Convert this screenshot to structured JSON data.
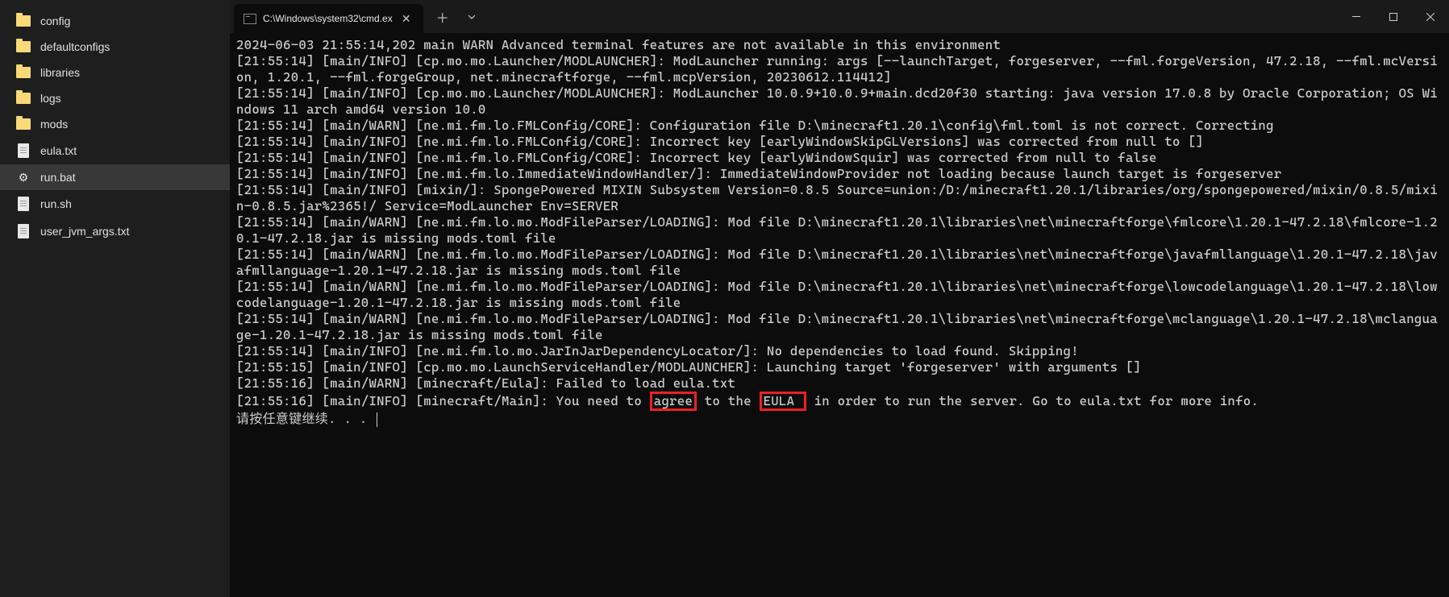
{
  "sidebar": {
    "items": [
      {
        "name": "config",
        "type": "folder"
      },
      {
        "name": "defaultconfigs",
        "type": "folder"
      },
      {
        "name": "libraries",
        "type": "folder"
      },
      {
        "name": "logs",
        "type": "folder"
      },
      {
        "name": "mods",
        "type": "folder"
      },
      {
        "name": "eula.txt",
        "type": "file"
      },
      {
        "name": "run.bat",
        "type": "gear",
        "selected": true
      },
      {
        "name": "run.sh",
        "type": "file"
      },
      {
        "name": "user_jvm_args.txt",
        "type": "file"
      }
    ]
  },
  "tab": {
    "title": "C:\\Windows\\system32\\cmd.ex"
  },
  "terminal": {
    "lines": [
      "2024-06-03 21:55:14,202 main WARN Advanced terminal features are not available in this environment",
      "[21:55:14] [main/INFO] [cp.mo.mo.Launcher/MODLAUNCHER]: ModLauncher running: args [--launchTarget, forgeserver, --fml.forgeVersion, 47.2.18, --fml.mcVersion, 1.20.1, --fml.forgeGroup, net.minecraftforge, --fml.mcpVersion, 20230612.114412]",
      "[21:55:14] [main/INFO] [cp.mo.mo.Launcher/MODLAUNCHER]: ModLauncher 10.0.9+10.0.9+main.dcd20f30 starting: java version 17.0.8 by Oracle Corporation; OS Windows 11 arch amd64 version 10.0",
      "[21:55:14] [main/WARN] [ne.mi.fm.lo.FMLConfig/CORE]: Configuration file D:\\minecraft1.20.1\\config\\fml.toml is not correct. Correcting",
      "[21:55:14] [main/INFO] [ne.mi.fm.lo.FMLConfig/CORE]: Incorrect key [earlyWindowSkipGLVersions] was corrected from null to []",
      "[21:55:14] [main/INFO] [ne.mi.fm.lo.FMLConfig/CORE]: Incorrect key [earlyWindowSquir] was corrected from null to false",
      "[21:55:14] [main/INFO] [ne.mi.fm.lo.ImmediateWindowHandler/]: ImmediateWindowProvider not loading because launch target is forgeserver",
      "[21:55:14] [main/INFO] [mixin/]: SpongePowered MIXIN Subsystem Version=0.8.5 Source=union:/D:/minecraft1.20.1/libraries/org/spongepowered/mixin/0.8.5/mixin-0.8.5.jar%2365!/ Service=ModLauncher Env=SERVER",
      "[21:55:14] [main/WARN] [ne.mi.fm.lo.mo.ModFileParser/LOADING]: Mod file D:\\minecraft1.20.1\\libraries\\net\\minecraftforge\\fmlcore\\1.20.1-47.2.18\\fmlcore-1.20.1-47.2.18.jar is missing mods.toml file",
      "[21:55:14] [main/WARN] [ne.mi.fm.lo.mo.ModFileParser/LOADING]: Mod file D:\\minecraft1.20.1\\libraries\\net\\minecraftforge\\javafmllanguage\\1.20.1-47.2.18\\javafmllanguage-1.20.1-47.2.18.jar is missing mods.toml file",
      "[21:55:14] [main/WARN] [ne.mi.fm.lo.mo.ModFileParser/LOADING]: Mod file D:\\minecraft1.20.1\\libraries\\net\\minecraftforge\\lowcodelanguage\\1.20.1-47.2.18\\lowcodelanguage-1.20.1-47.2.18.jar is missing mods.toml file",
      "[21:55:14] [main/WARN] [ne.mi.fm.lo.mo.ModFileParser/LOADING]: Mod file D:\\minecraft1.20.1\\libraries\\net\\minecraftforge\\mclanguage\\1.20.1-47.2.18\\mclanguage-1.20.1-47.2.18.jar is missing mods.toml file",
      "[21:55:14] [main/INFO] [ne.mi.fm.lo.mo.JarInJarDependencyLocator/]: No dependencies to load found. Skipping!",
      "[21:55:15] [main/INFO] [cp.mo.mo.LaunchServiceHandler/MODLAUNCHER]: Launching target 'forgeserver' with arguments []",
      "[21:55:16] [main/WARN] [minecraft/Eula]: Failed to load eula.txt"
    ],
    "final_line_prefix": "[21:55:16] [main/INFO] [minecraft/Main]: You need to ",
    "highlight1": "agree",
    "final_line_mid": " to the ",
    "highlight2": "EULA ",
    "final_line_suffix": "in order to run the server. Go to eula.txt for more info.",
    "prompt": "请按任意键继续. . . "
  }
}
